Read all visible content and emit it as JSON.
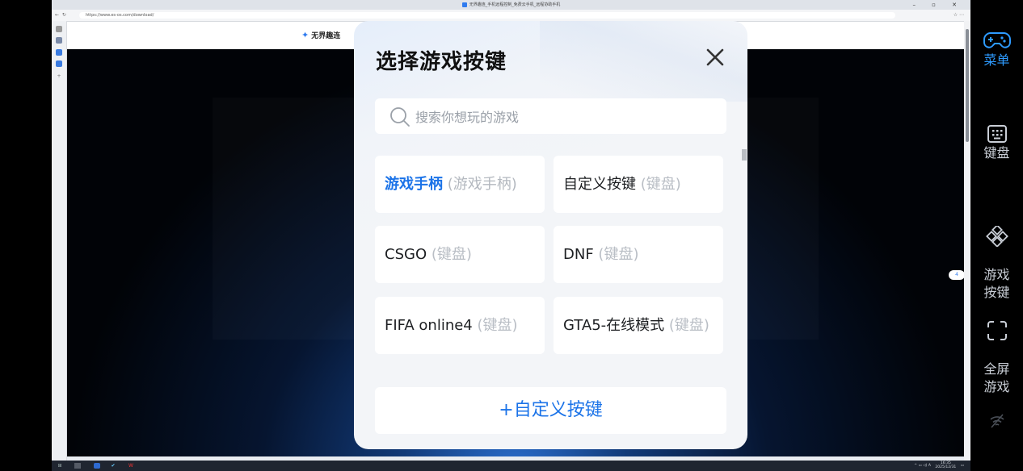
{
  "browser": {
    "title": "无界趣连_手机远程控制_免费云手机_远程协助手机",
    "url": "https://www.es-os.com/download/",
    "site_name": "无界趣连",
    "side_badge": "4"
  },
  "taskbar": {
    "time": "16:35",
    "date": "2025/12/31",
    "input_method": "A"
  },
  "toolbar": {
    "menu_label": "菜单",
    "keyboard_label": "键盘",
    "game_keys_label": "游戏\n按键",
    "fullscreen_label": "全屏\n游戏",
    "accent_color": "#2e9bff"
  },
  "modal": {
    "title": "选择游戏按键",
    "search_placeholder": "搜索你想玩的游戏",
    "games": [
      {
        "name": "游戏手柄",
        "type": "(游戏手柄)",
        "selected": true
      },
      {
        "name": "自定义按键",
        "type": "(键盘)",
        "selected": false
      },
      {
        "name": "CSGO",
        "type": "(键盘)",
        "selected": false
      },
      {
        "name": "DNF",
        "type": "(键盘)",
        "selected": false
      },
      {
        "name": "FIFA online4",
        "type": "(键盘)",
        "selected": false
      },
      {
        "name": "GTA5-在线模式",
        "type": "(键盘)",
        "selected": false
      }
    ],
    "custom_button_label": "+自定义按键",
    "selected_color": "#1b73e8"
  }
}
